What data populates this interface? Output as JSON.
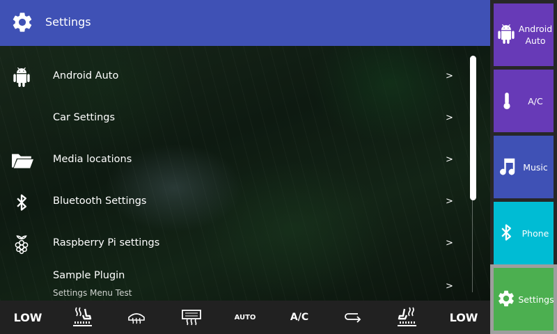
{
  "header": {
    "title": "Settings",
    "icon": "gear-icon",
    "color": "#3f51b5"
  },
  "menu": [
    {
      "label": "Android Auto",
      "sub": "",
      "icon": "android-icon",
      "arrow": ">"
    },
    {
      "label": "Car Settings",
      "sub": "",
      "icon": "",
      "arrow": ">"
    },
    {
      "label": "Media locations",
      "sub": "",
      "icon": "folder-icon",
      "arrow": ">"
    },
    {
      "label": "Bluetooth Settings",
      "sub": "",
      "icon": "bluetooth-icon",
      "arrow": ">"
    },
    {
      "label": "Raspberry Pi settings",
      "sub": "",
      "icon": "raspberry-pi-icon",
      "arrow": ">"
    },
    {
      "label": "Sample Plugin",
      "sub": "Settings Menu Test",
      "icon": "",
      "arrow": ">"
    }
  ],
  "bottom_bar": {
    "left_temp": "LOW",
    "right_temp": "LOW",
    "auto": "AUTO",
    "ac": "A/C",
    "icons": [
      "seat-heat-left-icon",
      "defrost-front-icon",
      "defrost-rear-icon",
      "recirculation-icon",
      "seat-heat-right-icon"
    ]
  },
  "side_tiles": [
    {
      "label": "Android Auto",
      "icon": "android-icon",
      "color": "#673ab7"
    },
    {
      "label": "A/C",
      "icon": "thermometer-icon",
      "color": "#673ab7"
    },
    {
      "label": "Music",
      "icon": "music-note-icon",
      "color": "#3f51b5"
    },
    {
      "label": "Phone",
      "icon": "bluetooth-icon",
      "color": "#00bcd4"
    },
    {
      "label": "Settings",
      "icon": "gear-icon",
      "color": "#4caf50"
    }
  ]
}
